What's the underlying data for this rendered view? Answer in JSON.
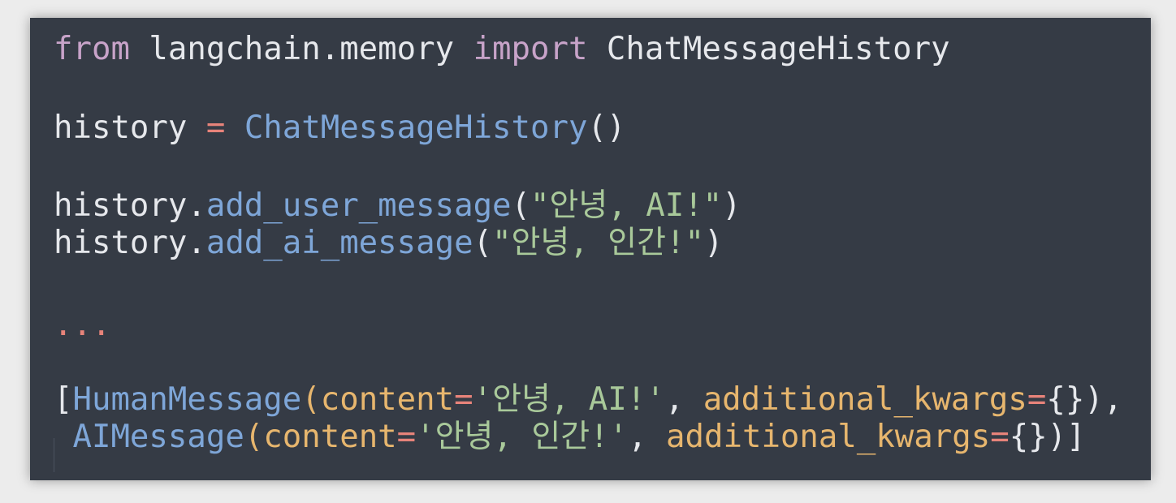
{
  "code": {
    "line1": {
      "kw_from": "from",
      "module": " langchain.memory ",
      "kw_import": "import",
      "cls": " ChatMessageHistory"
    },
    "line2": {
      "var": "history ",
      "op": "=",
      "sp": " ",
      "call": "ChatMessageHistory",
      "parens": "()"
    },
    "line3": {
      "obj": "history.",
      "method": "add_user_message",
      "open": "(",
      "str": "\"안녕, AI!\"",
      "close": ")"
    },
    "line4": {
      "obj": "history.",
      "method": "add_ai_message",
      "open": "(",
      "str": "\"안녕, 인간!\"",
      "close": ")"
    },
    "line5": {
      "ellipsis": "..."
    },
    "line6": {
      "bracket": "[",
      "cls": "HumanMessage",
      "open": "(",
      "param1": "content",
      "eq1": "=",
      "str": "'안녕, AI!'",
      "comma": ", ",
      "param2": "additional_kwargs",
      "eq2": "=",
      "tail": "{}),"
    },
    "line7": {
      "lead": " ",
      "cls": "AIMessage",
      "open": "(",
      "param1": "content",
      "eq1": "=",
      "str": "'안녕, 인간!'",
      "comma": ", ",
      "param2": "additional_kwargs",
      "eq2": "=",
      "tail": "{})]"
    }
  }
}
